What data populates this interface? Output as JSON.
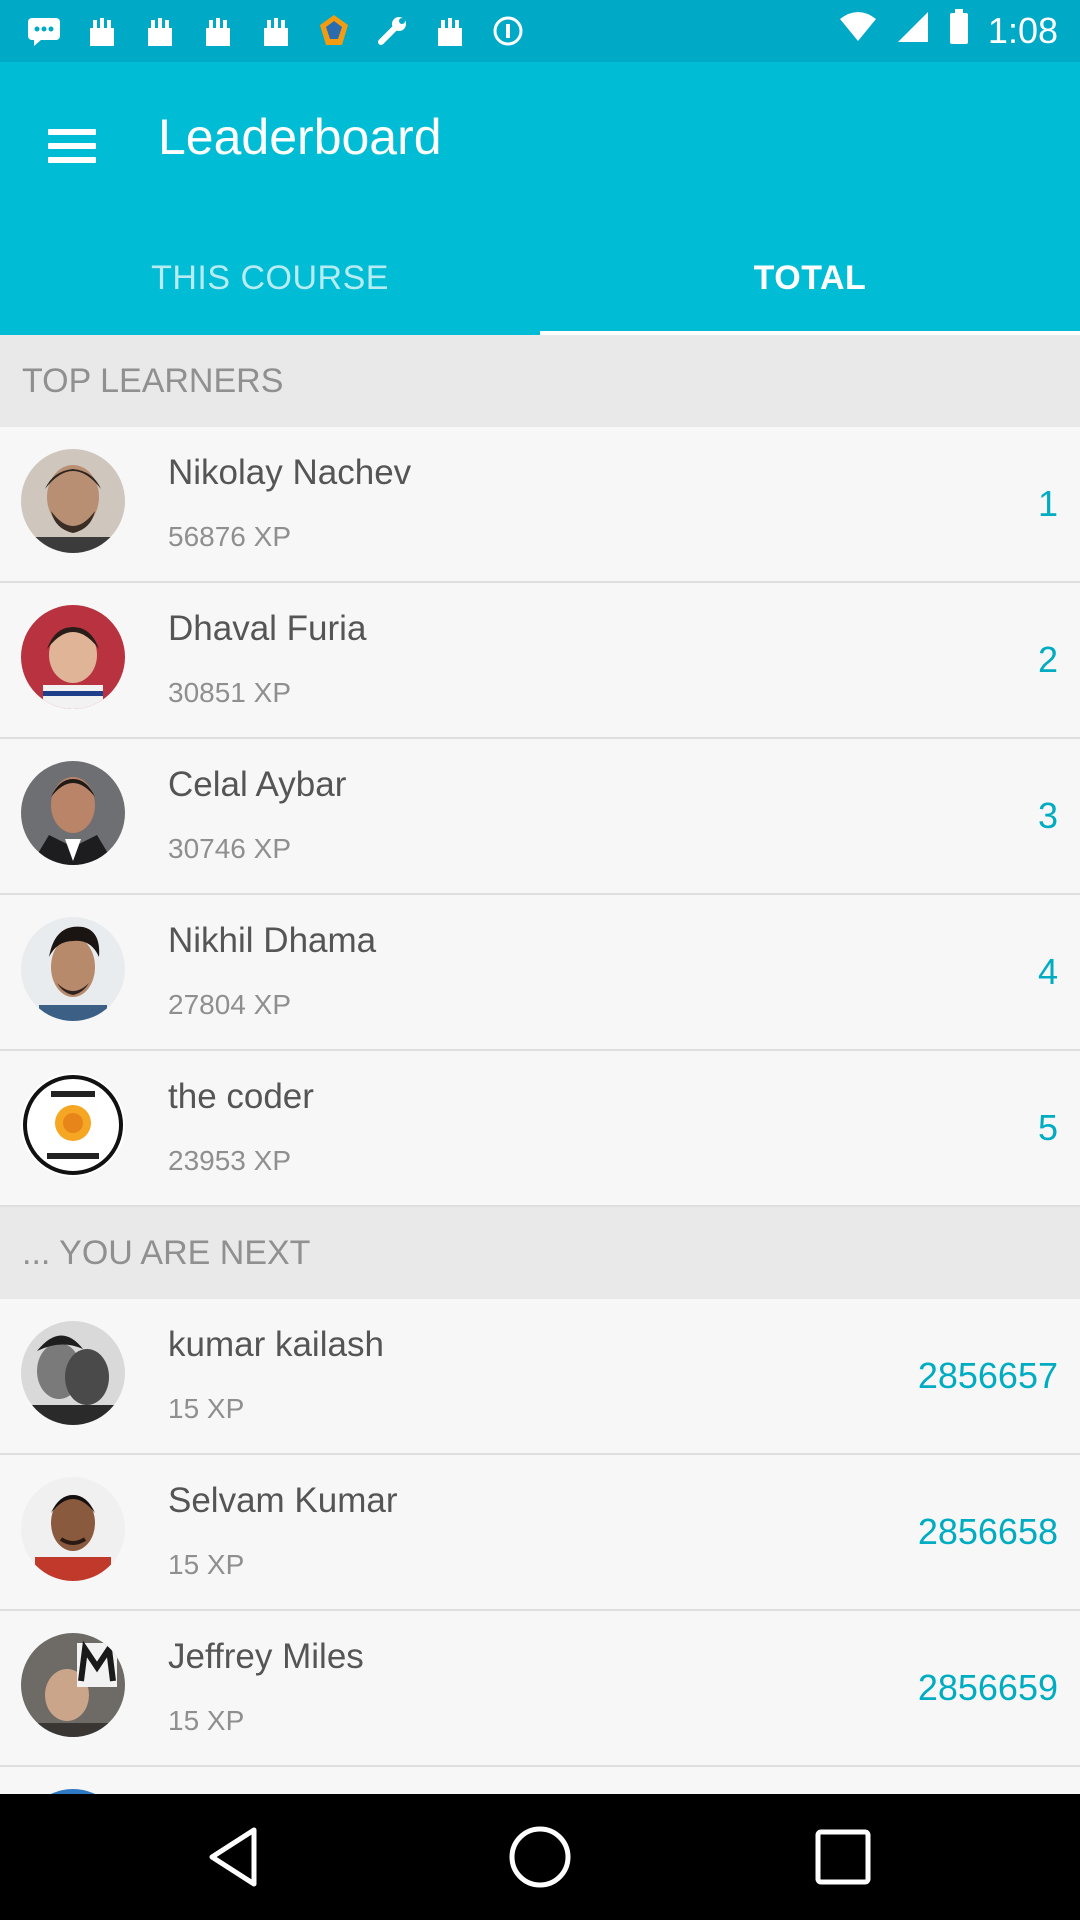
{
  "status_bar": {
    "time": "1:08",
    "icons": [
      "chat-icon",
      "cake-icon",
      "cake-icon",
      "cake-icon",
      "cake-icon",
      "app-icon",
      "wrench-icon",
      "cake-icon",
      "circle-icon"
    ]
  },
  "header": {
    "title": "Leaderboard",
    "tabs": [
      {
        "label": "THIS COURSE",
        "selected": false
      },
      {
        "label": "TOTAL",
        "selected": true
      }
    ]
  },
  "top_section": {
    "label": "TOP LEARNERS",
    "items": [
      {
        "name": "Nikolay Nachev",
        "xp": "56876 XP",
        "rank": "1"
      },
      {
        "name": "Dhaval Furia",
        "xp": "30851 XP",
        "rank": "2"
      },
      {
        "name": "Celal Aybar",
        "xp": "30746 XP",
        "rank": "3"
      },
      {
        "name": "Nikhil Dhama",
        "xp": "27804 XP",
        "rank": "4"
      },
      {
        "name": "the coder",
        "xp": "23953 XP",
        "rank": "5"
      }
    ]
  },
  "next_section": {
    "label": "... YOU ARE NEXT",
    "items": [
      {
        "name": "kumar kailash",
        "xp": "15 XP",
        "rank": "2856657"
      },
      {
        "name": "Selvam Kumar",
        "xp": "15 XP",
        "rank": "2856658"
      },
      {
        "name": "Jeffrey Miles",
        "xp": "15 XP",
        "rank": "2856659"
      }
    ]
  },
  "colors": {
    "accent": "#00bcd4",
    "status_bar": "#00a9c5",
    "rank_text": "#00acc1"
  }
}
